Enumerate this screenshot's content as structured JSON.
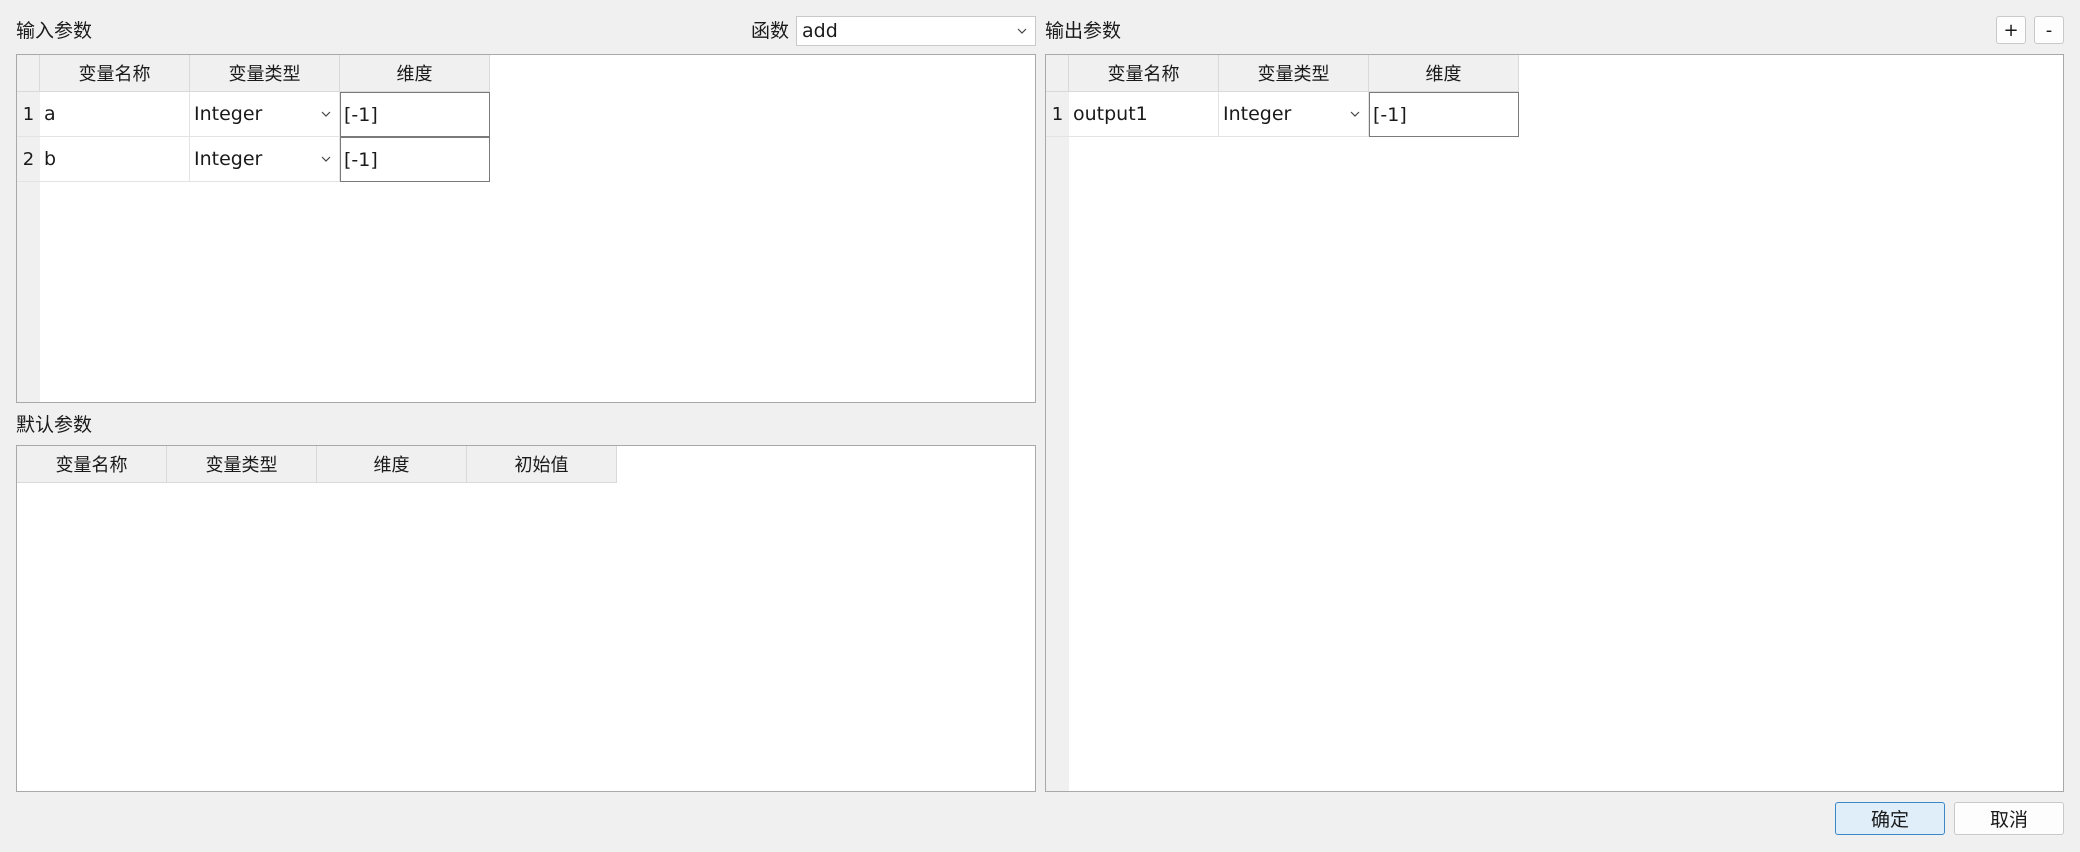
{
  "input_params": {
    "label": "输入参数",
    "columns": [
      "变量名称",
      "变量类型",
      "维度"
    ],
    "rows": [
      {
        "num": "1",
        "name": "a",
        "type": "Integer",
        "dim": "[-1]"
      },
      {
        "num": "2",
        "name": "b",
        "type": "Integer",
        "dim": "[-1]"
      }
    ]
  },
  "function": {
    "label": "函数",
    "value": "add"
  },
  "output_params": {
    "label": "输出参数",
    "add_label": "+",
    "remove_label": "-",
    "columns": [
      "变量名称",
      "变量类型",
      "维度"
    ],
    "rows": [
      {
        "num": "1",
        "name": "output1",
        "type": "Integer",
        "dim": "[-1]"
      }
    ]
  },
  "default_params": {
    "label": "默认参数",
    "columns": [
      "变量名称",
      "变量类型",
      "维度",
      "初始值"
    ]
  },
  "buttons": {
    "ok": "确定",
    "cancel": "取消"
  },
  "icons": {
    "combo": "chevron-down-icon"
  }
}
